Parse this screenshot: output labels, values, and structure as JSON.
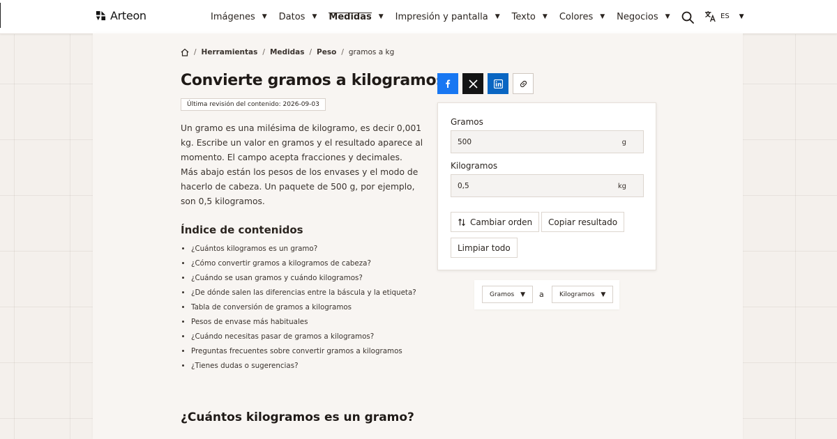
{
  "header": {
    "logo_text": "Arteon",
    "nav": [
      {
        "label": "Imágenes",
        "active": false
      },
      {
        "label": "Datos",
        "active": false
      },
      {
        "label": "Medidas",
        "active": true
      },
      {
        "label": "Impresión y pantalla",
        "active": false
      },
      {
        "label": "Texto",
        "active": false
      },
      {
        "label": "Colores",
        "active": false
      },
      {
        "label": "Negocios",
        "active": false
      }
    ],
    "search_icon": "search-icon",
    "language_icon": "translate-icon",
    "language": "ES"
  },
  "breadcrumb": {
    "home_icon": "home-icon",
    "items": [
      "Herramientas",
      "Medidas",
      "Peso"
    ],
    "current": "gramos a kg"
  },
  "article": {
    "title": "Convierte gramos a kilogramos",
    "revision": "Última revisión del contenido: 2026-09-03",
    "intro_1": "Un gramo es una milésima de kilogramo, es decir 0,001 kg. Escribe un valor en gramos y el resultado aparece al momento. El campo acepta fracciones y decimales.",
    "intro_2": "Más abajo están los pesos de los envases y el modo de hacerlo de cabeza. Un paquete de 500 g, por ejemplo, son 0,5 kilogramos.",
    "toc_title": "Índice de contenidos",
    "toc": [
      "¿Cuántos kilogramos es un gramo?",
      "¿Cómo convertir gramos a kilogramos de cabeza?",
      "¿Cuándo se usan gramos y cuándo kilogramos?",
      "¿De dónde salen las diferencias entre la báscula y la etiqueta?",
      "Tabla de conversión de gramos a kilogramos",
      "Pesos de envase más habituales",
      "¿Cuándo necesitas pasar de gramos a kilogramos?",
      "Preguntas frecuentes sobre convertir gramos a kilogramos",
      "¿Tienes dudas o sugerencias?"
    ],
    "section_1_title": "¿Cuántos kilogramos es un gramo?"
  },
  "share": {
    "icons": [
      "facebook-icon",
      "x-icon",
      "linkedin-icon",
      "link-icon"
    ],
    "colors": {
      "facebook": "#1877f2",
      "x": "#141414",
      "linkedin": "#0a66c2"
    }
  },
  "converter": {
    "from_label": "Gramos",
    "from_value": "500",
    "from_unit": "g",
    "to_label": "Kilogramos",
    "to_value": "0,5",
    "to_unit": "kg",
    "swap_label": "Cambiar orden",
    "copy_label": "Copiar resultado",
    "clear_label": "Limpiar todo"
  },
  "unit_selector": {
    "from": "Gramos",
    "separator": "a",
    "to": "Kilogramos"
  }
}
